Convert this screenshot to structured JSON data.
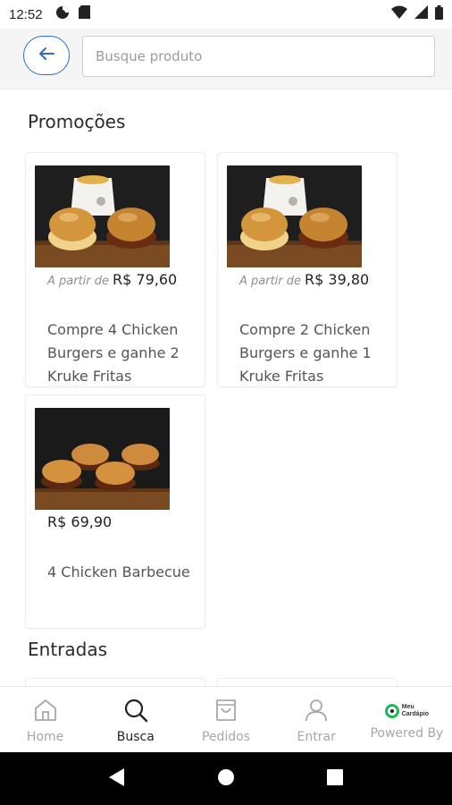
{
  "status_bar": {
    "time": "12:52",
    "left_icons": [
      "data-saver-icon",
      "sd-card-icon"
    ],
    "right_icons": [
      "wifi-icon",
      "signal-icon",
      "battery-icon"
    ]
  },
  "search": {
    "placeholder": "Busque produto",
    "value": "",
    "back_icon": "arrow-left-icon",
    "accent_color": "#2b6fcf"
  },
  "sections": [
    {
      "title": "Promoções",
      "products": [
        {
          "price_prefix": "A partir de",
          "price": "R$ 79,60",
          "name": "Compre 4 Chicken Burgers e ganhe 2 Kruke Fritas",
          "image": "two-burgers-with-fries"
        },
        {
          "price_prefix": "A partir de",
          "price": "R$ 39,80",
          "name": "Compre 2 Chicken Burgers e ganhe 1 Kruke Fritas",
          "image": "two-burgers-with-fries"
        },
        {
          "price_prefix": "",
          "price": "R$ 69,90",
          "name": "4 Chicken Barbecue",
          "image": "four-bbq-burgers"
        }
      ]
    },
    {
      "title": "Entradas",
      "products": []
    }
  ],
  "bottom_nav": {
    "items": [
      {
        "label": "Home",
        "icon": "home-icon",
        "active": false
      },
      {
        "label": "Busca",
        "icon": "search-icon",
        "active": true
      },
      {
        "label": "Pedidos",
        "icon": "shopping-bag-icon",
        "active": false
      },
      {
        "label": "Entrar",
        "icon": "user-icon",
        "active": false
      }
    ],
    "powered": {
      "label": "Powered By",
      "brand_line1": "Meu",
      "brand_line2": "Cardápio",
      "brand_color": "#1db954"
    }
  },
  "android_nav": [
    "back-triangle-icon",
    "home-circle-icon",
    "recents-square-icon"
  ]
}
